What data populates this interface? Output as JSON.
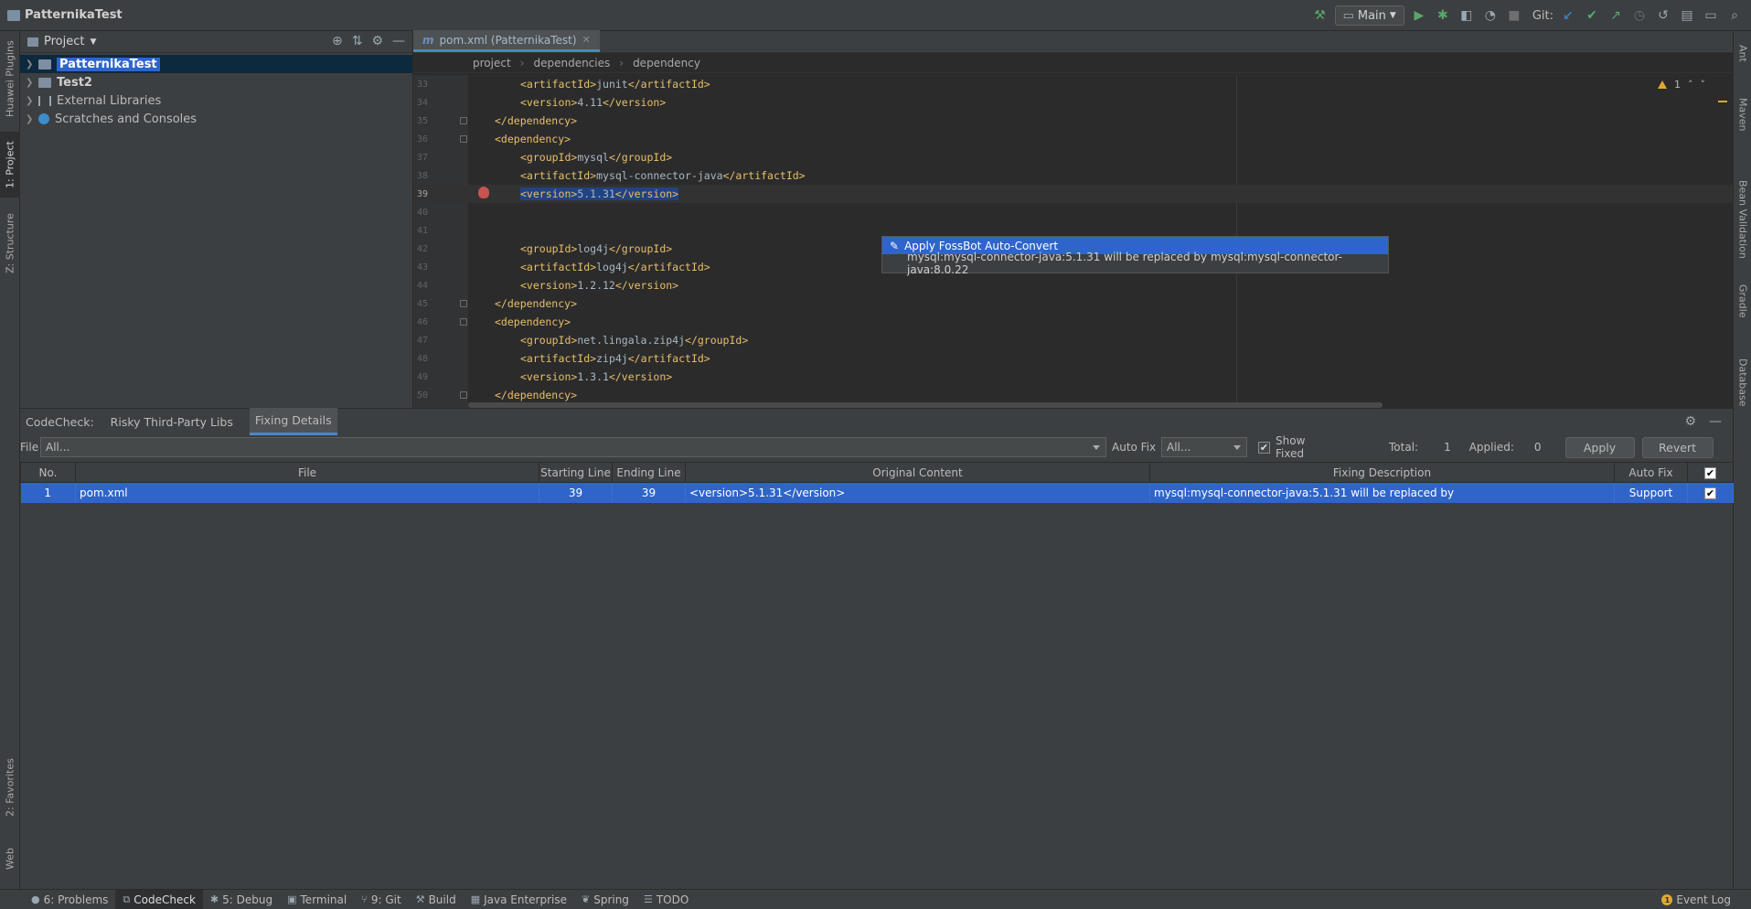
{
  "titlebar": {
    "project_name": "PatternikaTest",
    "run_config": "Main",
    "git_label": "Git:"
  },
  "left_strip": {
    "tabs": [
      "Huawei Plugins",
      "1: Project",
      "Z: Structure",
      "2: Favorites",
      "Web"
    ]
  },
  "right_strip": {
    "tabs": [
      "Ant",
      "Maven",
      "Bean Validation",
      "Gradle",
      "Database"
    ]
  },
  "project_panel": {
    "title": "Project",
    "tree": [
      {
        "label": "PatternikaTest",
        "selected": true,
        "bold": true
      },
      {
        "label": "Test2",
        "bold": true
      },
      {
        "label": "External Libraries"
      },
      {
        "label": "Scratches and Consoles"
      }
    ]
  },
  "editor": {
    "tab_label": "pom.xml (PatternikaTest)",
    "tab_prefix": "m",
    "breadcrumb": [
      "project",
      "dependencies",
      "dependency"
    ],
    "warning_count": "1",
    "lines": [
      {
        "num": "33",
        "pre": "            ",
        "open": "<artifactId>",
        "text": "junit",
        "close": "</artifactId>"
      },
      {
        "num": "34",
        "pre": "            ",
        "open": "<version>",
        "text": "4.11",
        "close": "</version>"
      },
      {
        "num": "35",
        "pre": "        ",
        "open": "</dependency>",
        "text": "",
        "close": ""
      },
      {
        "num": "36",
        "pre": "        ",
        "open": "<dependency>",
        "text": "",
        "close": ""
      },
      {
        "num": "37",
        "pre": "            ",
        "open": "<groupId>",
        "text": "mysql",
        "close": "</groupId>"
      },
      {
        "num": "38",
        "pre": "            ",
        "open": "<artifactId>",
        "text": "mysql-connector-java",
        "close": "</artifactId>"
      },
      {
        "num": "39",
        "pre": "            ",
        "open": "<version>",
        "text": "5.1.31",
        "close": "</version>"
      },
      {
        "num": "40",
        "pre": "",
        "open": "",
        "text": "",
        "close": ""
      },
      {
        "num": "41",
        "pre": "",
        "open": "",
        "text": "",
        "close": ""
      },
      {
        "num": "42",
        "pre": "            ",
        "open": "<groupId>",
        "text": "log4j",
        "close": "</groupId>"
      },
      {
        "num": "43",
        "pre": "            ",
        "open": "<artifactId>",
        "text": "log4j",
        "close": "</artifactId>"
      },
      {
        "num": "44",
        "pre": "            ",
        "open": "<version>",
        "text": "1.2.12",
        "close": "</version>"
      },
      {
        "num": "45",
        "pre": "        ",
        "open": "</dependency>",
        "text": "",
        "close": ""
      },
      {
        "num": "46",
        "pre": "        ",
        "open": "<dependency>",
        "text": "",
        "close": ""
      },
      {
        "num": "47",
        "pre": "            ",
        "open": "<groupId>",
        "text": "net.lingala.zip4j",
        "close": "</groupId>"
      },
      {
        "num": "48",
        "pre": "            ",
        "open": "<artifactId>",
        "text": "zip4j",
        "close": "</artifactId>"
      },
      {
        "num": "49",
        "pre": "            ",
        "open": "<version>",
        "text": "1.3.1",
        "close": "</version>"
      },
      {
        "num": "50",
        "pre": "        ",
        "open": "</dependency>",
        "text": "",
        "close": ""
      }
    ],
    "popup": {
      "action": "Apply FossBot Auto-Convert",
      "detail": "mysql:mysql-connector-java:5.1.31 will be replaced by mysql:mysql-connector-java:8.0.22"
    }
  },
  "codecheck": {
    "label": "CodeCheck:",
    "tabs": [
      "Risky Third-Party Libs",
      "Fixing Details"
    ],
    "active_tab": "Fixing Details",
    "filters": {
      "file_label": "File",
      "file_value": "All...",
      "autofix_label": "Auto Fix",
      "autofix_value": "All...",
      "show_fixed_label": "Show Fixed",
      "total_label": "Total:",
      "total_value": "1",
      "applied_label": "Applied:",
      "applied_value": "0",
      "apply_button": "Apply",
      "revert_button": "Revert"
    },
    "columns": [
      "No.",
      "File",
      "Starting Line",
      "Ending Line",
      "Original Content",
      "Fixing Description",
      "Auto Fix"
    ],
    "rows": [
      {
        "no": "1",
        "file": "pom.xml",
        "start": "39",
        "end": "39",
        "original": "<version>5.1.31</version>",
        "description": "mysql:mysql-connector-java:5.1.31 will be replaced by",
        "autofix": "Support"
      }
    ]
  },
  "statusbar": {
    "items": [
      {
        "label": "6: Problems",
        "icon": "problems-icon"
      },
      {
        "label": "CodeCheck",
        "icon": "codecheck-icon",
        "active": true
      },
      {
        "label": "5: Debug",
        "icon": "debug-icon"
      },
      {
        "label": "Terminal",
        "icon": "terminal-icon"
      },
      {
        "label": "9: Git",
        "icon": "git-icon"
      },
      {
        "label": "Build",
        "icon": "build-icon"
      },
      {
        "label": "Java Enterprise",
        "icon": "java-enterprise-icon"
      },
      {
        "label": "Spring",
        "icon": "spring-icon"
      },
      {
        "label": "TODO",
        "icon": "todo-icon"
      }
    ],
    "event_log": "Event Log",
    "event_count": "1"
  },
  "colors": {
    "accent": "#2f65ca",
    "tag": "#e8bf6a",
    "background": "#3c3f41",
    "editor_bg": "#2b2b2b"
  }
}
